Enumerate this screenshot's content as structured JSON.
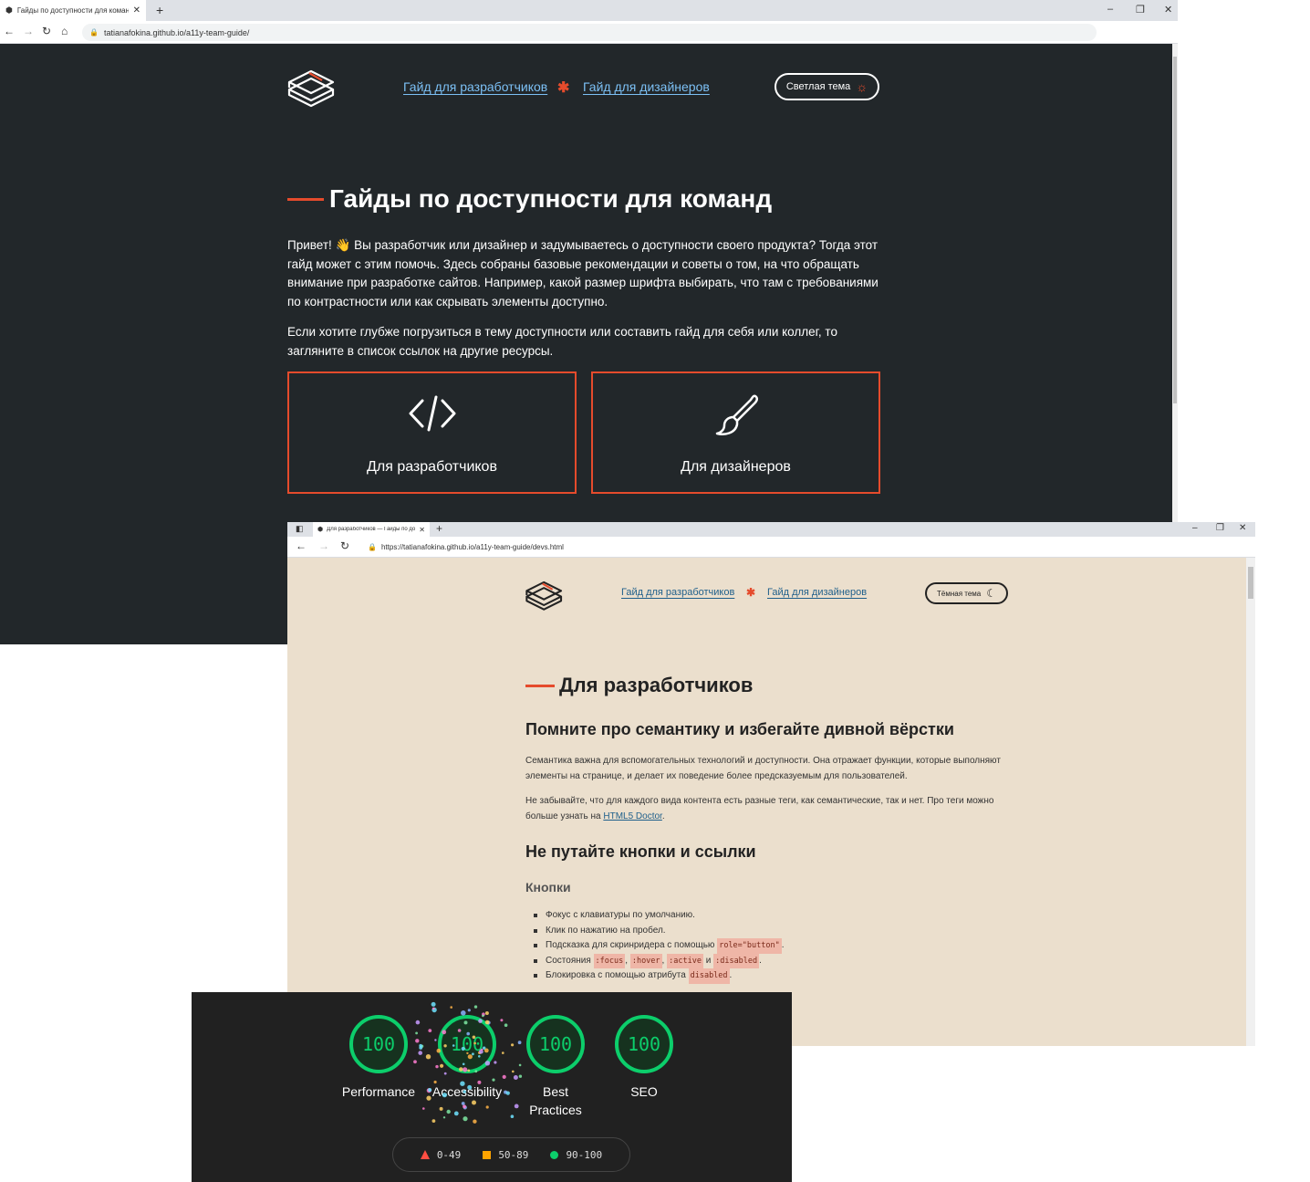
{
  "window1": {
    "tab_title": "Гайды по доступности для команд",
    "url": "tatianafokina.github.io/a11y-team-guide/",
    "nav": {
      "devs": "Гайд для разработчиков",
      "designers": "Гайд для дизайнеров",
      "separator": "✱"
    },
    "theme_button": "Светлая тема",
    "title": "Гайды по доступности для команд",
    "intro": "Привет! 👋 Вы разработчик или дизайнер и задумываетесь о доступности своего продукта? Тогда этот гайд может с этим помочь. Здесь собраны базовые рекомендации и советы о том, на что обращать внимание при разработке сайтов. Например, какой размер шрифта выбирать, что там с требованиями по контрастности или как скрывать элементы доступно.",
    "intro2": "Если хотите глубже погрузиться в тему доступности или составить гайд для себя или коллег, то загляните в список ссылок на другие ресурсы.",
    "cards": {
      "devs": "Для разработчиков",
      "designers": "Для дизайнеров"
    }
  },
  "window2": {
    "tab_title": "Для разработчиков — Гайды по доступности",
    "url": "https://tatianafokina.github.io/a11y-team-guide/devs.html",
    "nav": {
      "devs": "Гайд для разработчиков",
      "designers": "Гайд для дизайнеров",
      "separator": "✱"
    },
    "theme_button": "Тёмная тема",
    "title": "Для разработчиков",
    "h2_semantics": "Помните про семантику и избегайте дивной вёрстки",
    "p_semantics": "Семантика важна для вспомогательных технологий и доступности. Она отражает функции, которые выполняют элементы на странице, и делает их поведение более предсказуемым для пользователей.",
    "p_tags_before": "Не забывайте, что для каждого вида контента есть разные теги, как семантические, так и нет. Про теги можно больше узнать на ",
    "p_tags_link": "HTML5 Doctor",
    "p_tags_after": ".",
    "h2_buttons": "Не путайте кнопки и ссылки",
    "h3_buttons": "Кнопки",
    "list": {
      "i1": "Фокус с клавиатуры по умолчанию.",
      "i2": "Клик по нажатию на пробел.",
      "i3_before": "Подсказка для скринридера с помощью ",
      "i3_code": "role=\"button\"",
      "i3_after": ".",
      "i4_before": "Состояния ",
      "i4_c1": ":focus",
      "i4_c2": ":hover",
      "i4_c3": ":active",
      "i4_and": " и ",
      "i4_c4": ":disabled",
      "i4_after": ".",
      "i5_before": "Блокировка с помощью атрибута ",
      "i5_code": "disabled",
      "i5_after": "."
    }
  },
  "lighthouse": {
    "scores": [
      {
        "value": "100",
        "label": "Performance"
      },
      {
        "value": "100",
        "label": "Accessibility"
      },
      {
        "value": "100",
        "label": "Best Practices"
      },
      {
        "value": "100",
        "label": "SEO"
      }
    ],
    "legend": {
      "low": "0-49",
      "mid": "50-89",
      "high": "90-100"
    },
    "colors": {
      "pass": "#0cce6b",
      "average": "#ffa400",
      "fail": "#ff4e42"
    }
  },
  "colors": {
    "accent": "#e54b2c",
    "dark_bg": "#22272a",
    "light_bg": "#ebdfcd"
  }
}
